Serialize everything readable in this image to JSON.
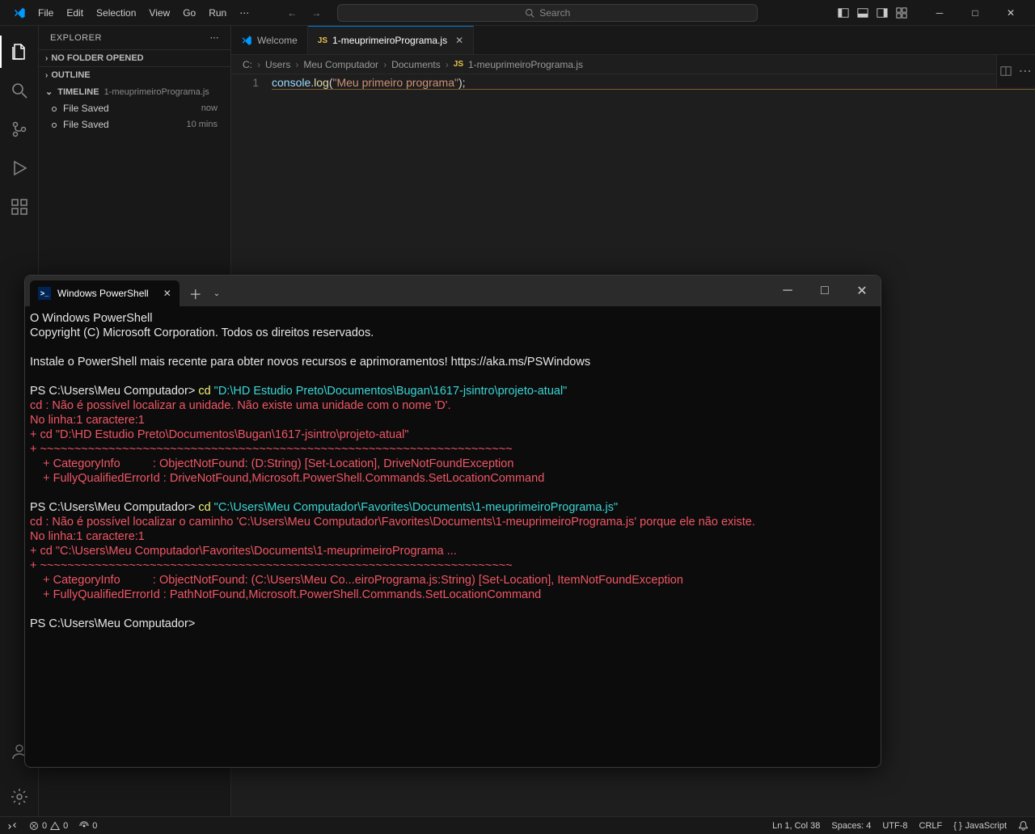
{
  "menu": {
    "file": "File",
    "edit": "Edit",
    "selection": "Selection",
    "view": "View",
    "go": "Go",
    "run": "Run"
  },
  "search_placeholder": "Search",
  "sidebar": {
    "title": "EXPLORER",
    "nofolder": "NO FOLDER OPENED",
    "outline": "OUTLINE",
    "timeline": "TIMELINE",
    "timeline_file": "1-meuprimeiroPrograma.js",
    "items": [
      {
        "label": "File Saved",
        "time": "now"
      },
      {
        "label": "File Saved",
        "time": "10 mins"
      }
    ]
  },
  "tabs": {
    "welcome": "Welcome",
    "file": "1-meuprimeiroPrograma.js"
  },
  "breadcrumb": [
    "C:",
    "Users",
    "Meu Computador",
    "Documents",
    "1-meuprimeiroPrograma.js"
  ],
  "code": {
    "line_no": "1",
    "obj": "console",
    "dot": ".",
    "fn": "log",
    "open": "(",
    "str": "\"Meu primeiro programa\"",
    "close": ");"
  },
  "ps": {
    "title": "Windows PowerShell",
    "l1": "O Windows PowerShell",
    "l2": "Copyright (C) Microsoft Corporation. Todos os direitos reservados.",
    "l3": "Instale o PowerShell mais recente para obter novos recursos e aprimoramentos! https://aka.ms/PSWindows",
    "p1": "PS C:\\Users\\Meu Computador> ",
    "cd1": "cd ",
    "path1": "\"D:\\HD Estudio Preto\\Documentos\\Bugan\\1617-jsintro\\projeto-atual\"",
    "e1a": "cd : Não é possível localizar a unidade. Não existe uma unidade com o nome 'D'.",
    "e1b": "No linha:1 caractere:1",
    "e1c": "+ cd \"D:\\HD Estudio Preto\\Documentos\\Bugan\\1617-jsintro\\projeto-atual\"",
    "e1d": "+ ~~~~~~~~~~~~~~~~~~~~~~~~~~~~~~~~~~~~~~~~~~~~~~~~~~~~~~~~~~~~~~~~~~~~~",
    "e1e": "    + CategoryInfo          : ObjectNotFound: (D:String) [Set-Location], DriveNotFoundException",
    "e1f": "    + FullyQualifiedErrorId : DriveNotFound,Microsoft.PowerShell.Commands.SetLocationCommand",
    "cd2": "cd ",
    "path2": "\"C:\\Users\\Meu Computador\\Favorites\\Documents\\1-meuprimeiroPrograma.js\"",
    "e2a": "cd : Não é possível localizar o caminho 'C:\\Users\\Meu Computador\\Favorites\\Documents\\1-meuprimeiroPrograma.js' porque ele não existe.",
    "e2b": "No linha:1 caractere:1",
    "e2c": "+ cd \"C:\\Users\\Meu Computador\\Favorites\\Documents\\1-meuprimeiroPrograma ...",
    "e2d": "+ ~~~~~~~~~~~~~~~~~~~~~~~~~~~~~~~~~~~~~~~~~~~~~~~~~~~~~~~~~~~~~~~~~~~~~",
    "e2e": "    + CategoryInfo          : ObjectNotFound: (C:\\Users\\Meu Co...eiroPrograma.js:String) [Set-Location], ItemNotFoundException",
    "e2f": "    + FullyQualifiedErrorId : PathNotFound,Microsoft.PowerShell.Commands.SetLocationCommand",
    "p3": "PS C:\\Users\\Meu Computador>"
  },
  "status": {
    "errors": "0",
    "warnings": "0",
    "ports": "0",
    "ln": "Ln 1, Col 38",
    "spaces": "Spaces: 4",
    "enc": "UTF-8",
    "eol": "CRLF",
    "lang": "JavaScript"
  }
}
